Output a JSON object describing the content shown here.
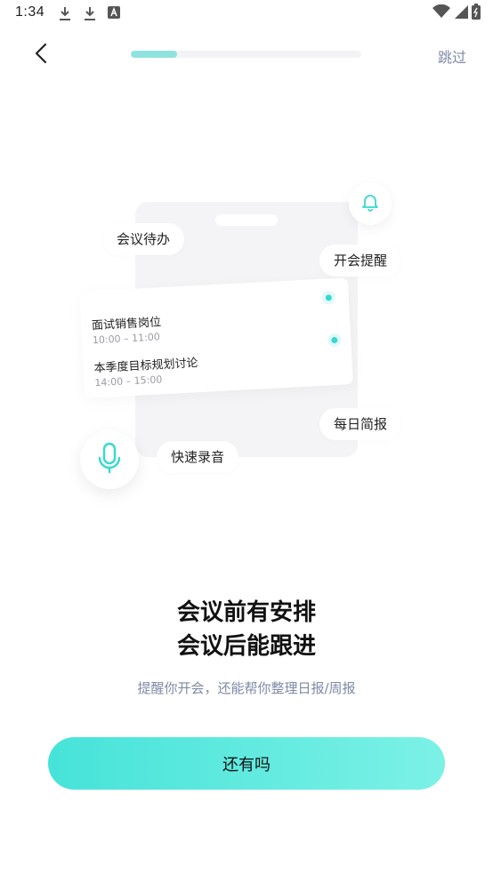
{
  "status_bar": {
    "time": "1:34",
    "icons": [
      "download-icon",
      "download-icon",
      "text-a-icon"
    ],
    "right_icons": [
      "wifi-icon",
      "cell-signal-icon",
      "battery-icon"
    ]
  },
  "nav": {
    "back_icon": "chevron-left-icon",
    "skip_label": "跳过",
    "progress": 0.2
  },
  "illustration": {
    "todo_label": "会议待办",
    "reminder_label": "开会提醒",
    "daily_report_label": "每日简报",
    "quick_record_label": "快速录音",
    "bell_icon": "bell-icon",
    "mic_icon": "microphone-icon",
    "meetings": [
      {
        "title": "面试销售岗位",
        "time": "10:00 – 11:00"
      },
      {
        "title": "本季度目标规划讨论",
        "time": "14:00 – 15:00"
      }
    ]
  },
  "headline": {
    "line1": "会议前有安排",
    "line2": "会议后能跟进"
  },
  "subtitle": "提醒你开会，还能帮你整理日报/周报",
  "cta_label": "还有吗",
  "colors": {
    "accent": "#46e3d9",
    "progress_fill": "#8fe3df",
    "muted_text": "#7f8aa6"
  }
}
